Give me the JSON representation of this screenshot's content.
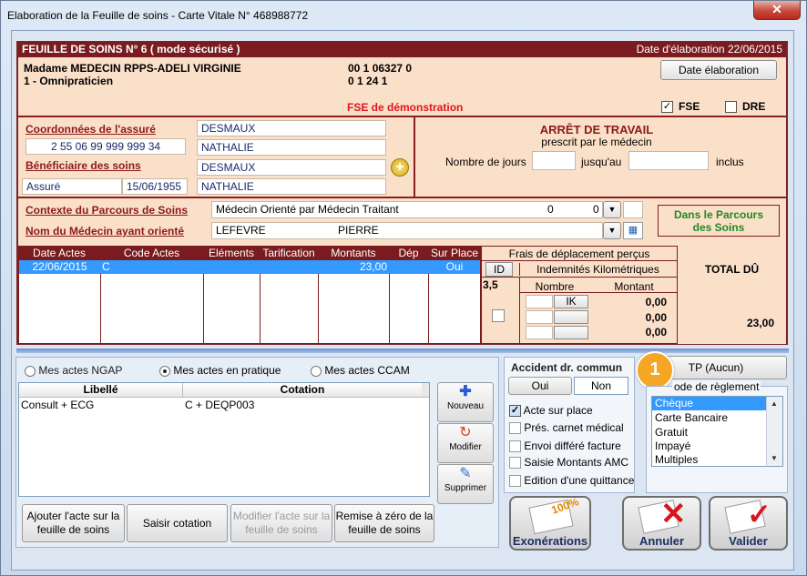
{
  "window": {
    "title": "Elaboration de la Feuille de soins - Carte Vitale N° 468988772",
    "close_label": "✕"
  },
  "fse": {
    "header_left": "FEUILLE DE SOINS  N° 6 ( mode sécurisé )",
    "header_right": "Date d'élaboration 22/06/2015",
    "doctor_name": "Madame MEDECIN RPPS-ADELI VIRGINIE",
    "doctor_type": "1 - Omnipraticien",
    "code1": "00 1 06327 0",
    "code2": "0 1 24 1",
    "date_btn": "Date élaboration",
    "demo_label": "FSE de démonstration",
    "fse_chk_label": "FSE",
    "fse_checked": "✓",
    "dre_chk_label": "DRE"
  },
  "assure": {
    "coord_label": "Coordonnées de l'assuré",
    "nir": "2 55 06 99 999 999 34",
    "nom": "DESMAUX",
    "prenom": "NATHALIE",
    "benef_label": "Bénéficiaire des soins",
    "benef_nom": "DESMAUX",
    "benef_prenom": "NATHALIE",
    "qualite": "Assuré",
    "naissance": "15/06/1955"
  },
  "arret": {
    "title": "ARRÊT DE TRAVAIL",
    "subtitle": "prescrit par le médecin",
    "nb_jours_label": "Nombre de jours",
    "jusquau_label": "jusqu'au",
    "inclus_label": "inclus"
  },
  "parcours": {
    "contexte_label": "Contexte du Parcours de Soins",
    "contexte_value": "Médecin Orienté par Médecin Traitant",
    "contexte_n1": "0",
    "contexte_n2": "0",
    "medecin_label": "Nom du Médecin ayant orienté",
    "medecin_nom": "LEFEVRE",
    "medecin_prenom": "PIERRE",
    "status_line1": "Dans le Parcours",
    "status_line2": "des Soins"
  },
  "actes_table": {
    "columns": [
      "Date Actes",
      "Code Actes",
      "Eléments",
      "Tarification",
      "Montants",
      "Dép",
      "Sur Place"
    ],
    "rows": [
      {
        "date": "22/06/2015",
        "code": "C",
        "elements": "",
        "tarif": "",
        "montant": "23,00",
        "dep": "",
        "sur_place": "Oui"
      }
    ]
  },
  "frais": {
    "title": "Frais de déplacement perçus",
    "id_label": "ID",
    "ik_title": "Indemnités Kilométriques",
    "id_value": "3,5",
    "nombre_label": "Nombre",
    "montant_label": "Montant",
    "ik_btn": "IK",
    "m1": "0,00",
    "m2": "0,00",
    "m3": "0,00",
    "total_label": "TOTAL DÛ",
    "total_value": "23,00"
  },
  "lower": {
    "radio1": "Mes actes NGAP",
    "radio2": "Mes actes en pratique",
    "radio3": "Mes actes CCAM",
    "list_col1": "Libellé",
    "list_col2": "Cotation",
    "list_rows": [
      {
        "libelle": "Consult + ECG",
        "cotation": "C + DEQP003"
      }
    ],
    "nouveau": "Nouveau",
    "modifier": "Modifier",
    "supprimer": "Supprimer",
    "btn_ajouter": "Ajouter l'acte sur la feuille de soins",
    "btn_saisir": "Saisir cotation",
    "btn_modifier_acte": "Modifier l'acte sur la feuille de soins",
    "btn_remise": "Remise à zéro de la feuille de soins"
  },
  "accident": {
    "title": "Accident dr. commun",
    "oui": "Oui",
    "non": "Non",
    "options": [
      {
        "label": "Acte sur place",
        "checked": "✓"
      },
      {
        "label": "Prés. carnet médical",
        "checked": ""
      },
      {
        "label": "Envoi différé facture",
        "checked": ""
      },
      {
        "label": "Saisie Montants AMC",
        "checked": ""
      },
      {
        "label": "Edition d'une quittance",
        "checked": ""
      }
    ]
  },
  "reglement": {
    "badge": "1",
    "tp_btn": "TP (Aucun)",
    "group_label": "Mode de règlement",
    "group_label_visible": "ode de règlement",
    "items": [
      "Chèque",
      "Carte Bancaire",
      "Gratuit",
      "Impayé",
      "Multiples"
    ]
  },
  "actions": {
    "exonerations": "Exonérations",
    "annuler": "Annuler",
    "valider": "Valider",
    "stamp": "100%"
  },
  "colors": {
    "dark_red": "#7a1c1f",
    "panel": "#fbe0c9",
    "select_blue": "#3399ff",
    "badge_orange": "#f5a623"
  }
}
